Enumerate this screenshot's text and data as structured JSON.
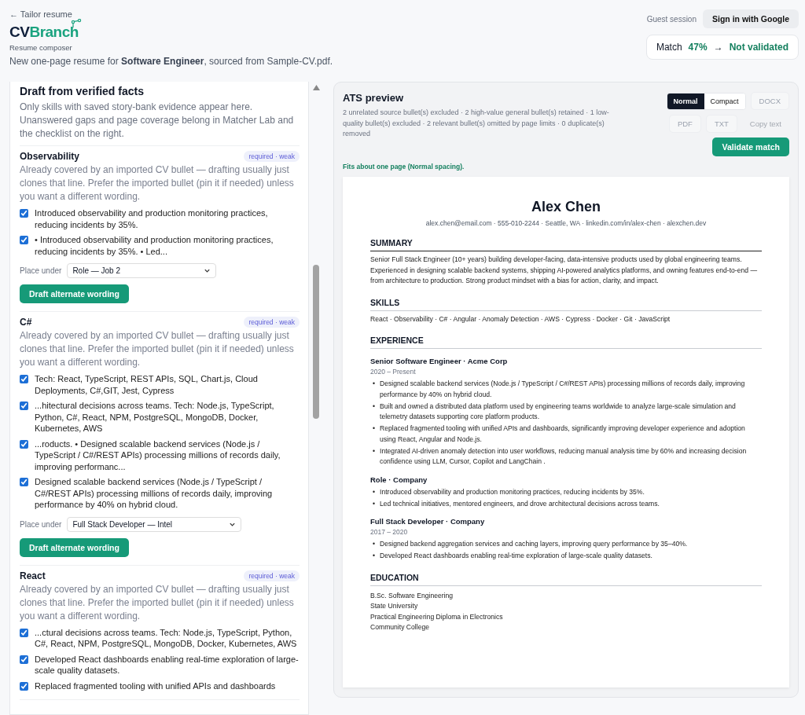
{
  "header": {
    "back_link": "← Tailor resume",
    "logo": {
      "part_1": "CV",
      "part_2": "Branch"
    },
    "subtitle": "Resume composer",
    "description": "New one-page resume for **Software Engineer**, sourced from Sample-CV.pdf."
  },
  "session": {
    "label": "Guest session",
    "sign_in": "Sign in with Google"
  },
  "match": {
    "label": "Match",
    "score": "47%",
    "arrow": "→",
    "status": "Not validated"
  },
  "draft_panel": {
    "title": "Draft from verified facts",
    "intro": "Only skills with saved story-bank evidence appear here. Unanswered gaps and page coverage belong in Matcher Lab and the checklist on the right.",
    "skills": [
      {
        "name": "Observability",
        "tag": "required · weak",
        "note": "Already covered by an imported CV bullet — drafting usually just clones that line. Prefer the imported bullet (pin it if needed) unless you want a different wording.",
        "bullets": [
          {
            "text": "Introduced observability and production monitoring practices, reducing incidents by 35%.",
            "checked": true
          },
          {
            "text": "• Introduced observability and production monitoring practices, reducing incidents by 35%. • Led...",
            "checked": true
          }
        ],
        "place_label": "Place under",
        "place_value": "Role — Job 2",
        "action": "Draft alternate wording"
      },
      {
        "name": "C#",
        "tag": "required · weak",
        "note": "Already covered by an imported CV bullet — drafting usually just clones that line. Prefer the imported bullet (pin it if needed) unless you want a different wording.",
        "bullets": [
          {
            "text": "Tech: React, TypeScript, REST APIs, SQL, Chart.js, Cloud Deployments, C#,GIT, Jest, Cypress",
            "checked": true
          },
          {
            "text": "...hitectural decisions across teams. Tech: Node.js, TypeScript, Python, C#, React, NPM, PostgreSQL, MongoDB, Docker, Kubernetes, AWS",
            "checked": true
          },
          {
            "text": "...roducts. • Designed scalable backend services (Node.js / TypeScript / C#/REST APIs) processing millions of records daily, improving performanc...",
            "checked": true
          },
          {
            "text": "Designed scalable backend services (Node.js / TypeScript / C#/REST APIs) processing millions of records daily, improving performance by 40% on hybrid cloud.",
            "checked": true
          }
        ],
        "place_label": "Place under",
        "place_value": "Full Stack Developer — Intel",
        "action": "Draft alternate wording"
      },
      {
        "name": "React",
        "tag": "required · weak",
        "note": "Already covered by an imported CV bullet — drafting usually just clones that line. Prefer the imported bullet (pin it if needed) unless you want a different wording.",
        "bullets": [
          {
            "text": "...ctural decisions across teams. Tech: Node.js, TypeScript, Python, C#, React, NPM, PostgreSQL, MongoDB, Docker, Kubernetes, AWS",
            "checked": true
          },
          {
            "text": "Developed React dashboards enabling real-time exploration of large-scale quality datasets.",
            "checked": true
          },
          {
            "text": "Replaced fragmented tooling with unified APIs and dashboards",
            "checked": true
          }
        ]
      }
    ]
  },
  "preview": {
    "title": "ATS preview",
    "summary": "2 unrelated source bullet(s) excluded · 2 high-value general bullet(s) retained · 1 low-quality bullet(s) excluded · 2 relevant bullet(s) omitted by page limits · 0 duplicate(s) removed",
    "modes": [
      {
        "label": "Normal",
        "selected": true
      },
      {
        "label": "Compact",
        "selected": false
      }
    ],
    "exports": [
      {
        "label": "DOCX",
        "disabled": true,
        "kind": "file"
      },
      {
        "label": "PDF",
        "disabled": true,
        "kind": "file"
      },
      {
        "label": "TXT",
        "disabled": true,
        "kind": "file"
      },
      {
        "label": "Copy text",
        "disabled": true,
        "kind": "copy"
      }
    ],
    "validate": "Validate match",
    "fit_note": "Fits about one page (Normal spacing).",
    "resume": {
      "bullet_marker": "•",
      "name": "Alex Chen",
      "contact": "alex.chen@email.com · 555-010-2244 · Seattle, WA · linkedin.com/in/alex-chen · alexchen.dev",
      "sections": [
        {
          "kind": "paragraph",
          "heading": "SUMMARY",
          "text": "Senior Full Stack Engineer (10+ years) building developer-facing, data-intensive products used by global engineering teams. Experienced in designing scalable backend systems, shipping AI-powered analytics platforms, and owning features end-to-end — from architecture to production. Strong product mindset with a bias for action, clarity, and impact."
        },
        {
          "kind": "paragraph",
          "heading": "SKILLS",
          "text": "React · Observability · C# · Angular · Anomaly Detection · AWS · Cypress · Docker · Git · JavaScript"
        },
        {
          "kind": "jobs",
          "heading": "EXPERIENCE",
          "jobs": [
            {
              "title": "Senior Software Engineer · Acme Corp",
              "dates": "2020 – Present",
              "bullets": [
                "Designed scalable backend services (Node.js / TypeScript / C#/REST APIs) processing millions of records daily, improving performance by 40% on hybrid cloud.",
                "Built and owned a distributed data platform used by engineering teams worldwide to analyze large-scale simulation and telemetry datasets supporting core platform products.",
                "Replaced fragmented tooling with unified APIs and dashboards, significantly improving developer experience and adoption using React, Angular and Node.js.",
                "Integrated AI-driven anomaly detection into user workflows, reducing manual analysis time by 60% and increasing decision confidence using LLM, Cursor, Copilot and LangChain ."
              ]
            },
            {
              "title": "Role · Company",
              "bullets": [
                "Introduced observability and production monitoring practices, reducing incidents by 35%.",
                "Led technical initiatives, mentored engineers, and drove architectural decisions across teams."
              ]
            },
            {
              "title": "Full Stack Developer · Company",
              "dates": "2017 – 2020",
              "bullets": [
                "Designed backend aggregation services and caching layers, improving query performance by 35–40%.",
                "Developed React dashboards enabling real-time exploration of large-scale quality datasets."
              ]
            }
          ]
        },
        {
          "kind": "lines",
          "heading": "EDUCATION",
          "lines": [
            "B.Sc. Software Engineering",
            "State University",
            "Practical Engineering Diploma in Electronics",
            "Community College"
          ]
        }
      ]
    }
  }
}
